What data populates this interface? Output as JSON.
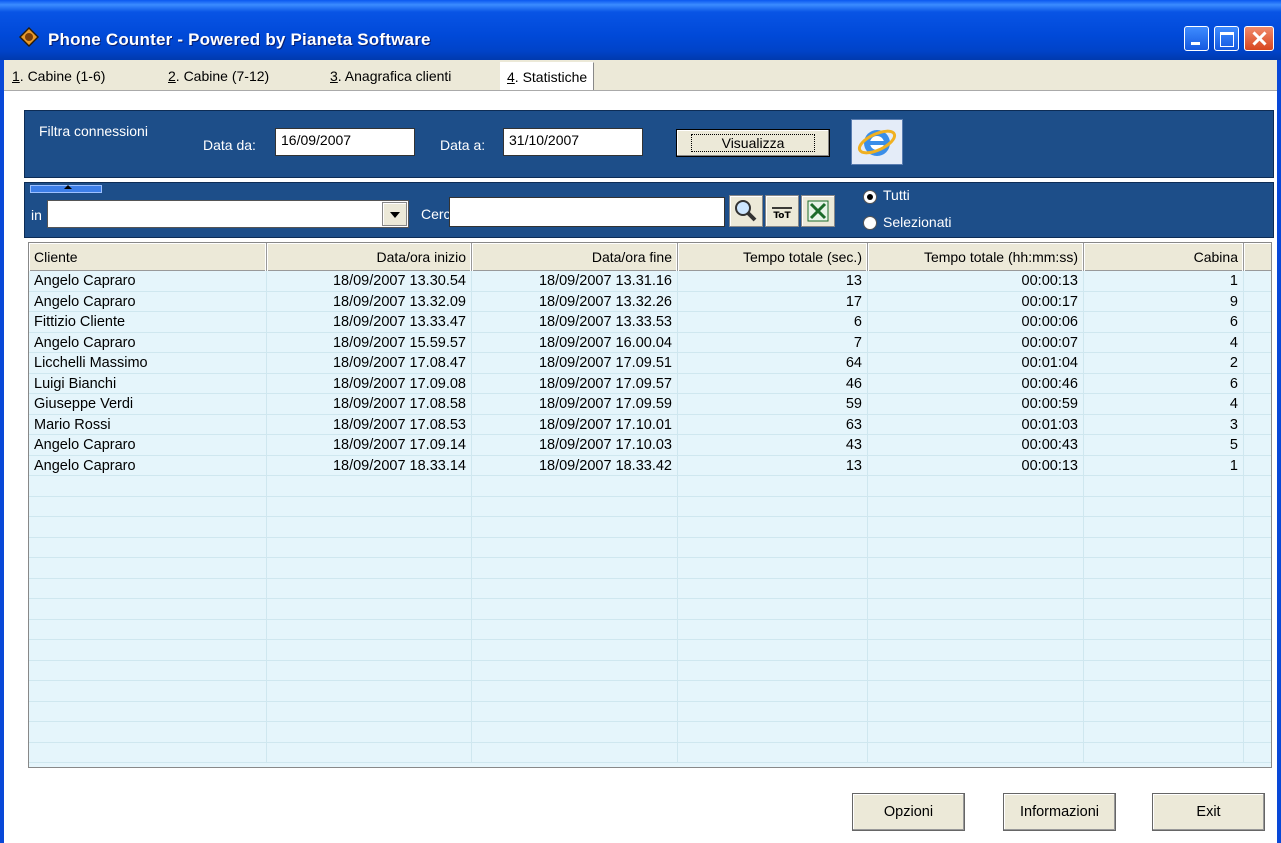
{
  "window": {
    "title": "Phone Counter - Powered by Pianeta Software"
  },
  "tabs": [
    {
      "key": "1",
      "label": ". Cabine (1-6)"
    },
    {
      "key": "2",
      "label": ". Cabine (7-12)"
    },
    {
      "key": "3",
      "label": ". Anagrafica clienti"
    },
    {
      "key": "4",
      "label": ". Statistiche",
      "active": true
    }
  ],
  "filter": {
    "title": "Filtra connessioni",
    "from_label": "Data da:",
    "from_value": "16/09/2007",
    "to_label": "Data a:",
    "to_value": "31/10/2007",
    "show_button": "Visualizza"
  },
  "search": {
    "in_label": "in",
    "in_value": "",
    "search_label": "Cerca",
    "search_value": "",
    "radio_all": "Tutti",
    "radio_selected": "Selezionati"
  },
  "table": {
    "columns": [
      "Cliente",
      "Data/ora inizio",
      "Data/ora fine",
      "Tempo totale (sec.)",
      "Tempo totale (hh:mm:ss)",
      "Cabina"
    ],
    "rows": [
      [
        "Angelo Capraro",
        "18/09/2007 13.30.54",
        "18/09/2007 13.31.16",
        "13",
        "00:00:13",
        "1"
      ],
      [
        "Angelo Capraro",
        "18/09/2007 13.32.09",
        "18/09/2007 13.32.26",
        "17",
        "00:00:17",
        "9"
      ],
      [
        "Fittizio Cliente",
        "18/09/2007 13.33.47",
        "18/09/2007 13.33.53",
        "6",
        "00:00:06",
        "6"
      ],
      [
        "Angelo Capraro",
        "18/09/2007 15.59.57",
        "18/09/2007 16.00.04",
        "7",
        "00:00:07",
        "4"
      ],
      [
        "Licchelli Massimo",
        "18/09/2007 17.08.47",
        "18/09/2007 17.09.51",
        "64",
        "00:01:04",
        "2"
      ],
      [
        "Luigi Bianchi",
        "18/09/2007 17.09.08",
        "18/09/2007 17.09.57",
        "46",
        "00:00:46",
        "6"
      ],
      [
        "Giuseppe Verdi",
        "18/09/2007 17.08.58",
        "18/09/2007 17.09.59",
        "59",
        "00:00:59",
        "4"
      ],
      [
        "Mario Rossi",
        "18/09/2007 17.08.53",
        "18/09/2007 17.10.01",
        "63",
        "00:01:03",
        "3"
      ],
      [
        "Angelo Capraro",
        "18/09/2007 17.09.14",
        "18/09/2007 17.10.03",
        "43",
        "00:00:43",
        "5"
      ],
      [
        "Angelo Capraro",
        "18/09/2007 18.33.14",
        "18/09/2007 18.33.42",
        "13",
        "00:00:13",
        "1"
      ]
    ]
  },
  "footer": {
    "options": "Opzioni",
    "info": "Informazioni",
    "exit": "Exit"
  }
}
